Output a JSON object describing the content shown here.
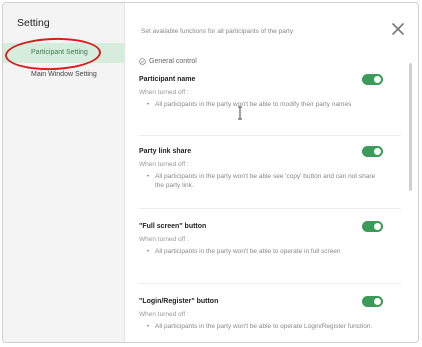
{
  "sidebar": {
    "title": "Setting",
    "items": [
      {
        "label": "Participant Setting",
        "active": true
      },
      {
        "label": "Main Window Setting",
        "active": false
      }
    ]
  },
  "header": {
    "description": "Set available functions for all participants of the party"
  },
  "section": {
    "icon": "shield-icon",
    "title": "General control"
  },
  "settings": [
    {
      "title": "Participant name",
      "when_off": "When turned off :",
      "detail": "All participants in the party won't be able to modify their party names",
      "enabled": true
    },
    {
      "title": "Party link share",
      "when_off": "When turned off :",
      "detail": "All participants in the party won't be able see 'copy' button and can not share the party link.",
      "enabled": true
    },
    {
      "title": "\"Full screen\" button",
      "when_off": "When turned off :",
      "detail": "All participants in the party won't be able to operate in full screen",
      "enabled": true
    },
    {
      "title": "\"Login/Register\" button",
      "when_off": "When turned off :",
      "detail": "All participants in the party won't be able to operate Login/Register function.",
      "enabled": true
    }
  ],
  "colors": {
    "accent": "#3c9a5a",
    "active_item_bg": "#d6ecdc",
    "annotation": "#d62020"
  }
}
